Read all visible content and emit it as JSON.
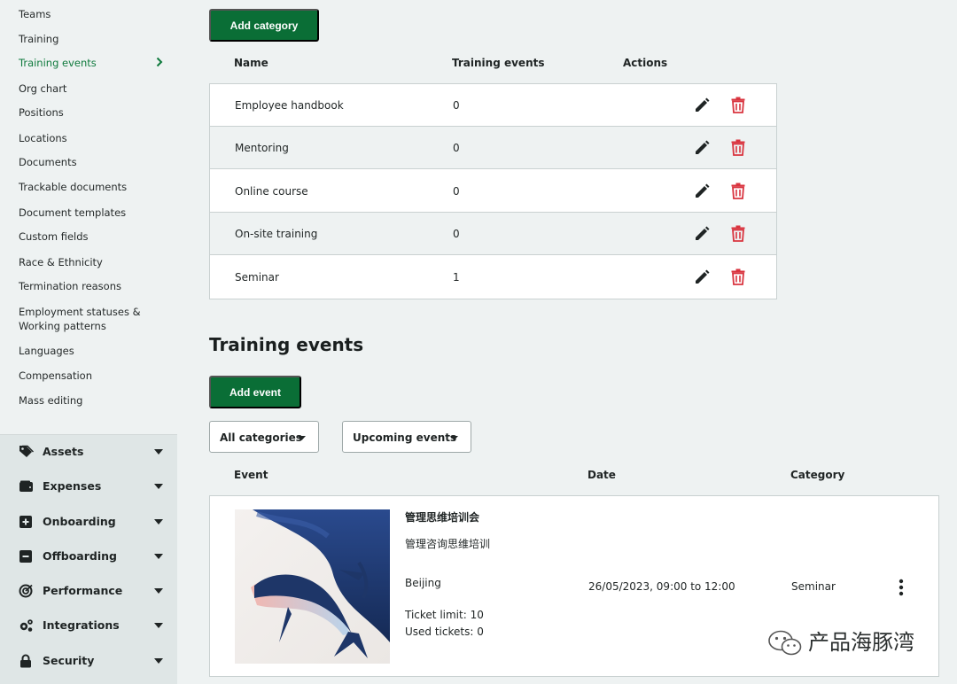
{
  "sidebar": {
    "links": [
      {
        "label": "Teams",
        "active": false
      },
      {
        "label": "Training",
        "active": false
      },
      {
        "label": "Training events",
        "active": true
      },
      {
        "label": "Org chart",
        "active": false
      },
      {
        "label": "Positions",
        "active": false
      },
      {
        "label": "Locations",
        "active": false
      },
      {
        "label": "Documents",
        "active": false
      },
      {
        "label": "Trackable documents",
        "active": false
      },
      {
        "label": "Document templates",
        "active": false
      },
      {
        "label": "Custom fields",
        "active": false
      },
      {
        "label": "Race & Ethnicity",
        "active": false
      },
      {
        "label": "Termination reasons",
        "active": false
      },
      {
        "label": "Employment statuses &",
        "active": false
      },
      {
        "label": "Working patterns",
        "active": false
      },
      {
        "label": "Languages",
        "active": false
      },
      {
        "label": "Compensation",
        "active": false
      },
      {
        "label": "Mass editing",
        "active": false
      }
    ],
    "sections": [
      {
        "label": "Assets",
        "icon": "tag-icon"
      },
      {
        "label": "Expenses",
        "icon": "wallet-icon"
      },
      {
        "label": "Onboarding",
        "icon": "plus-square-icon"
      },
      {
        "label": "Offboarding",
        "icon": "minus-square-icon"
      },
      {
        "label": "Performance",
        "icon": "target-icon"
      },
      {
        "label": "Integrations",
        "icon": "gears-icon"
      },
      {
        "label": "Security",
        "icon": "lock-icon"
      }
    ]
  },
  "categories": {
    "add_label": "Add category",
    "headers": {
      "name": "Name",
      "count": "Training events",
      "actions": "Actions"
    },
    "rows": [
      {
        "name": "Employee handbook",
        "count": "0"
      },
      {
        "name": "Mentoring",
        "count": "0"
      },
      {
        "name": "Online course",
        "count": "0"
      },
      {
        "name": "On-site training",
        "count": "0"
      },
      {
        "name": "Seminar",
        "count": "1"
      }
    ]
  },
  "events": {
    "title": "Training events",
    "add_label": "Add event",
    "filter_category": "All categories",
    "filter_time": "Upcoming events",
    "headers": {
      "event": "Event",
      "date": "Date",
      "category": "Category"
    },
    "items": [
      {
        "title": "管理思维培训会",
        "description": "管理咨询思维培训",
        "location": "Beijing",
        "ticket_limit": "Ticket limit: 10",
        "used_tickets": "Used tickets: 0",
        "date": "26/05/2023, 09:00 to 12:00",
        "category": "Seminar"
      }
    ]
  },
  "watermark": {
    "text": "产品海豚湾"
  },
  "colors": {
    "accent": "#0a6e36",
    "active_link": "#0f7a3d",
    "delete": "#d9343f"
  }
}
